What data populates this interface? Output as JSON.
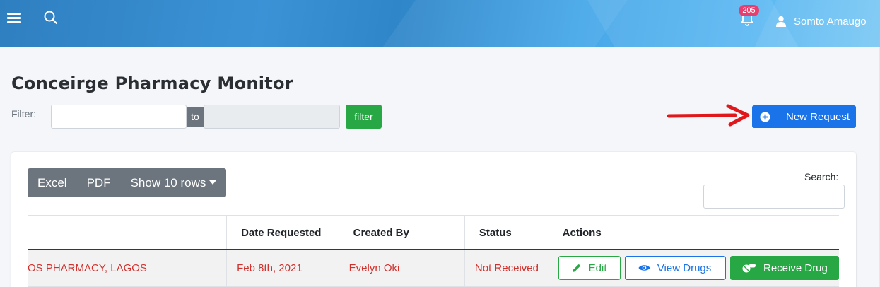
{
  "topbar": {
    "notification_count": "205",
    "user_name": "Somto Amaugo"
  },
  "page": {
    "title": "Conceirge Pharmacy Monitor",
    "filter_label": "Filter:",
    "to_label": "to",
    "filter_button": "filter",
    "new_request_button": "New Request"
  },
  "toolbar": {
    "excel": "Excel",
    "pdf": "PDF",
    "show_rows": "Show 10 rows",
    "search_label": "Search:"
  },
  "table": {
    "headers": [
      "",
      "Date Requested",
      "Created By",
      "Status",
      "Actions"
    ],
    "rows": [
      {
        "pharmacy": "OS PHARMACY, LAGOS",
        "date_requested": "Feb 8th, 2021",
        "created_by": "Evelyn Oki",
        "status": "Not Received",
        "actions": {
          "edit": "Edit",
          "view": "View Drugs",
          "receive": "Receive Drug"
        }
      }
    ]
  },
  "colors": {
    "primary": "#1a73e8",
    "success": "#28a745",
    "danger_text": "#d0312d",
    "badge": "#e83e6f",
    "annotation_arrow": "#e0181b"
  }
}
